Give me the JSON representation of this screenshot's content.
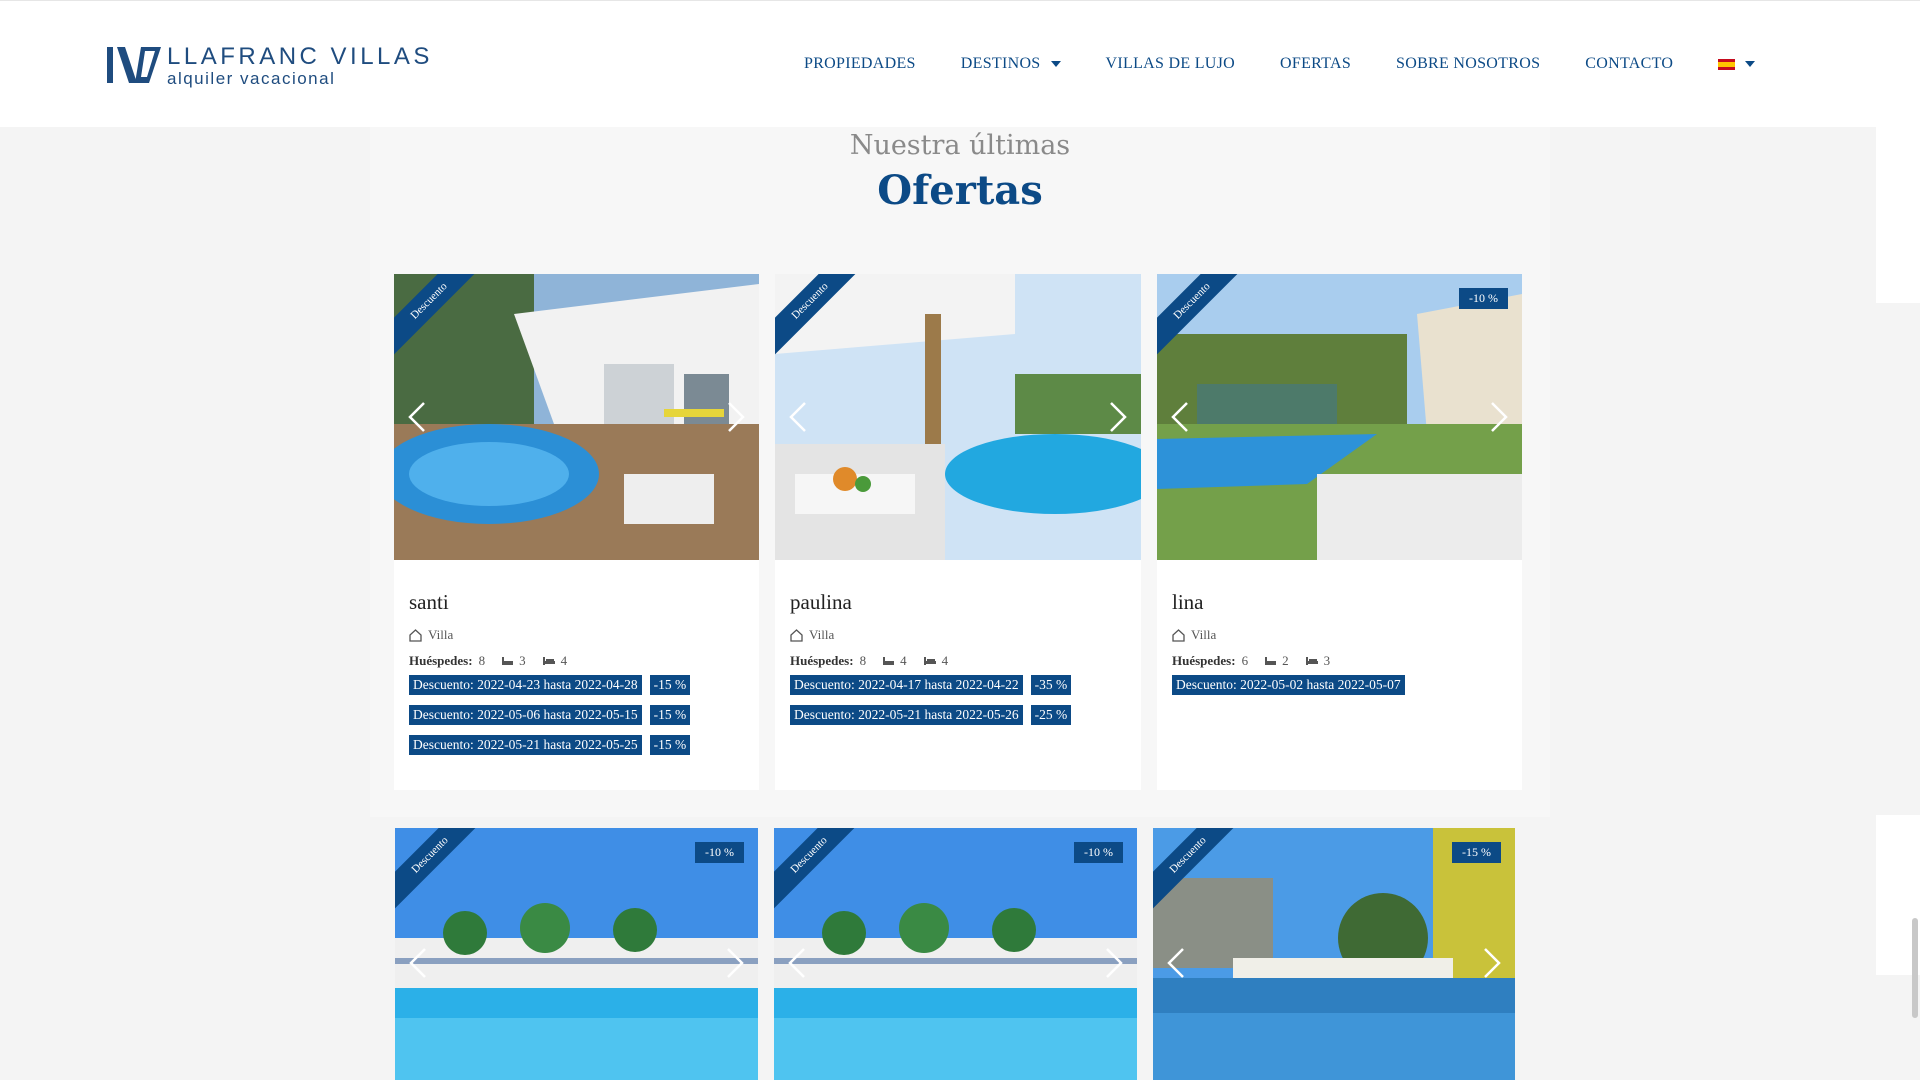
{
  "brand": {
    "name": "LLAFRANC VILLAS",
    "tagline": "alquiler vacacional",
    "color": "#1f4c7f"
  },
  "nav": {
    "items": [
      {
        "label": "PROPIEDADES"
      },
      {
        "label": "DESTINOS",
        "dropdown": true
      },
      {
        "label": "VILLAS DE LUJO"
      },
      {
        "label": "OFERTAS"
      },
      {
        "label": "SOBRE NOSOTROS"
      },
      {
        "label": "CONTACTO"
      }
    ],
    "language": "es"
  },
  "section": {
    "subtitle": "Nuestra últimas",
    "title": "Ofertas"
  },
  "labels": {
    "ribbon": "Descuento",
    "guests_label": "Huéspedes:"
  },
  "accent_color": "#0c4a86",
  "cards": [
    {
      "name": "santi",
      "type": "Villa",
      "guests": "8",
      "baths": "3",
      "beds": "4",
      "badge": "",
      "discounts": [
        {
          "text": "Descuento: 2022-04-23 hasta 2022-04-28",
          "pct": "-15 %"
        },
        {
          "text": "Descuento: 2022-05-06 hasta 2022-05-15",
          "pct": "-15 %"
        },
        {
          "text": "Descuento: 2022-05-21 hasta 2022-05-25",
          "pct": "-15 %"
        }
      ]
    },
    {
      "name": "paulina",
      "type": "Villa",
      "guests": "8",
      "baths": "4",
      "beds": "4",
      "badge": "",
      "discounts": [
        {
          "text": "Descuento: 2022-04-17 hasta 2022-04-22",
          "pct": "-35 %"
        },
        {
          "text": "Descuento: 2022-05-21 hasta 2022-05-26",
          "pct": "-25 %"
        }
      ]
    },
    {
      "name": "lina",
      "type": "Villa",
      "guests": "6",
      "baths": "2",
      "beds": "3",
      "badge": "-10 %",
      "discounts": [
        {
          "text": "Descuento: 2022-05-02 hasta 2022-05-07",
          "pct": ""
        }
      ]
    }
  ],
  "cards_row2": [
    {
      "badge": "-10 %"
    },
    {
      "badge": "-10 %"
    },
    {
      "badge": "-15 %"
    }
  ]
}
